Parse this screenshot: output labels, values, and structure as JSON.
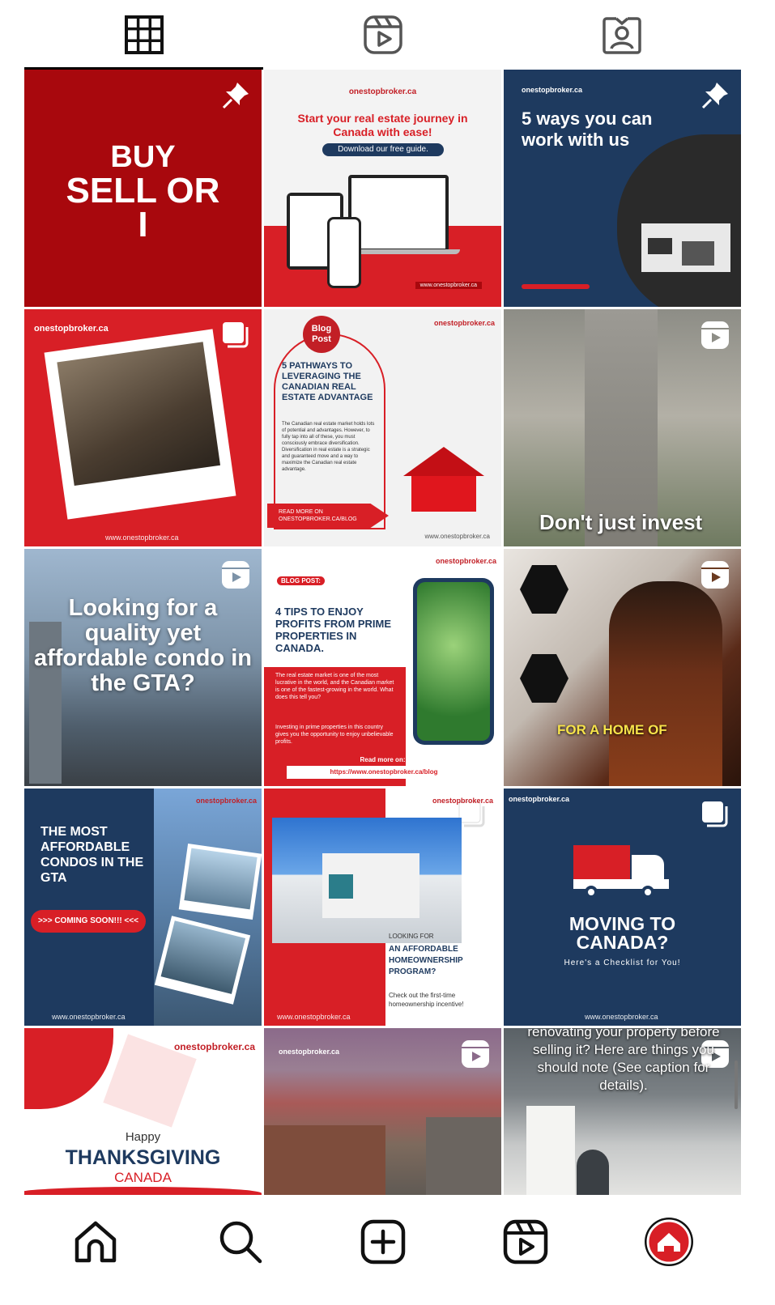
{
  "colors": {
    "brand_red": "#d81f26",
    "dark_red": "#a8080d",
    "navy": "#1e3a5f",
    "white": "#ffffff"
  },
  "tabs": [
    {
      "icon": "grid-icon",
      "active": true
    },
    {
      "icon": "reels-icon",
      "active": false
    },
    {
      "icon": "tagged-icon",
      "active": false
    }
  ],
  "posts": {
    "p1": {
      "line1": "BUY",
      "line2": "SELL OR",
      "line3": "I"
    },
    "p2": {
      "brand": "onestopbroker.ca",
      "headline": "Start your real estate journey in Canada with ease!",
      "cta": "Download our free guide.",
      "url": "www.onestopbroker.ca"
    },
    "p3": {
      "brand": "onestopbroker.ca",
      "headline": "5 ways you can work with us"
    },
    "p4": {
      "brand": "onestopbroker.ca",
      "url": "www.onestopbroker.ca"
    },
    "p5": {
      "brand": "onestopbroker.ca",
      "tag": "Blog Post",
      "headline": "5 PATHWAYS TO LEVERAGING THE CANADIAN REAL ESTATE ADVANTAGE",
      "body": "The Canadian real estate market holds lots of potential and advantages. However, to fully tap into all of these, you must consciously embrace diversification. Diversification in real estate is a strategic and guaranteed move and a way to maximize the Canadian real estate advantage.",
      "cta": "READ MORE ON ONESTOPBROKER.CA/BLOG",
      "url": "www.onestopbroker.ca"
    },
    "p6": {
      "caption": "Don't just invest"
    },
    "p7": {
      "caption": "Looking for a quality yet affordable condo in the GTA?"
    },
    "p8": {
      "brand": "onestopbroker.ca",
      "tag": "BLOG POST:",
      "headline": "4 TIPS TO ENJOY PROFITS FROM PRIME PROPERTIES IN CANADA.",
      "body1": "The real estate market is one of the most lucrative in the world, and the Canadian market is one of the fastest-growing in the world. What does this tell you?",
      "body2": "Investing in prime properties in this country gives you the opportunity to enjoy unbelievable profits.",
      "read_more": "Read more on:",
      "link": "https://www.onestopbroker.ca/blog"
    },
    "p9": {
      "caption": "FOR A HOME OF"
    },
    "p10": {
      "brand": "onestopbroker.ca",
      "headline": "THE MOST AFFORDABLE CONDOS IN THE GTA",
      "cta": ">>> COMING SOON!!! <<<",
      "url": "www.onestopbroker.ca"
    },
    "p11": {
      "brand": "onestopbroker.ca",
      "small": "LOOKING FOR",
      "headline": "AN AFFORDABLE HOMEOWNERSHIP PROGRAM?",
      "body": "Check out the first-time homeownership incentive!",
      "url": "www.onestopbroker.ca"
    },
    "p12": {
      "brand": "onestopbroker.ca",
      "headline": "MOVING TO CANADA?",
      "sub": "Here's a Checklist for You!",
      "url": "www.onestopbroker.ca"
    },
    "p13": {
      "brand": "onestopbroker.ca",
      "happy": "Happy",
      "headline": "THANKSGIVING",
      "sub": "CANADA"
    },
    "p14": {
      "brand": "onestopbroker.ca"
    },
    "p15": {
      "caption": "renovating your property before selling it? Here are things you should note (See caption for details)."
    }
  },
  "bottom_nav": [
    {
      "icon": "home-icon"
    },
    {
      "icon": "search-icon"
    },
    {
      "icon": "create-icon"
    },
    {
      "icon": "reels-icon"
    },
    {
      "icon": "profile-avatar"
    }
  ]
}
